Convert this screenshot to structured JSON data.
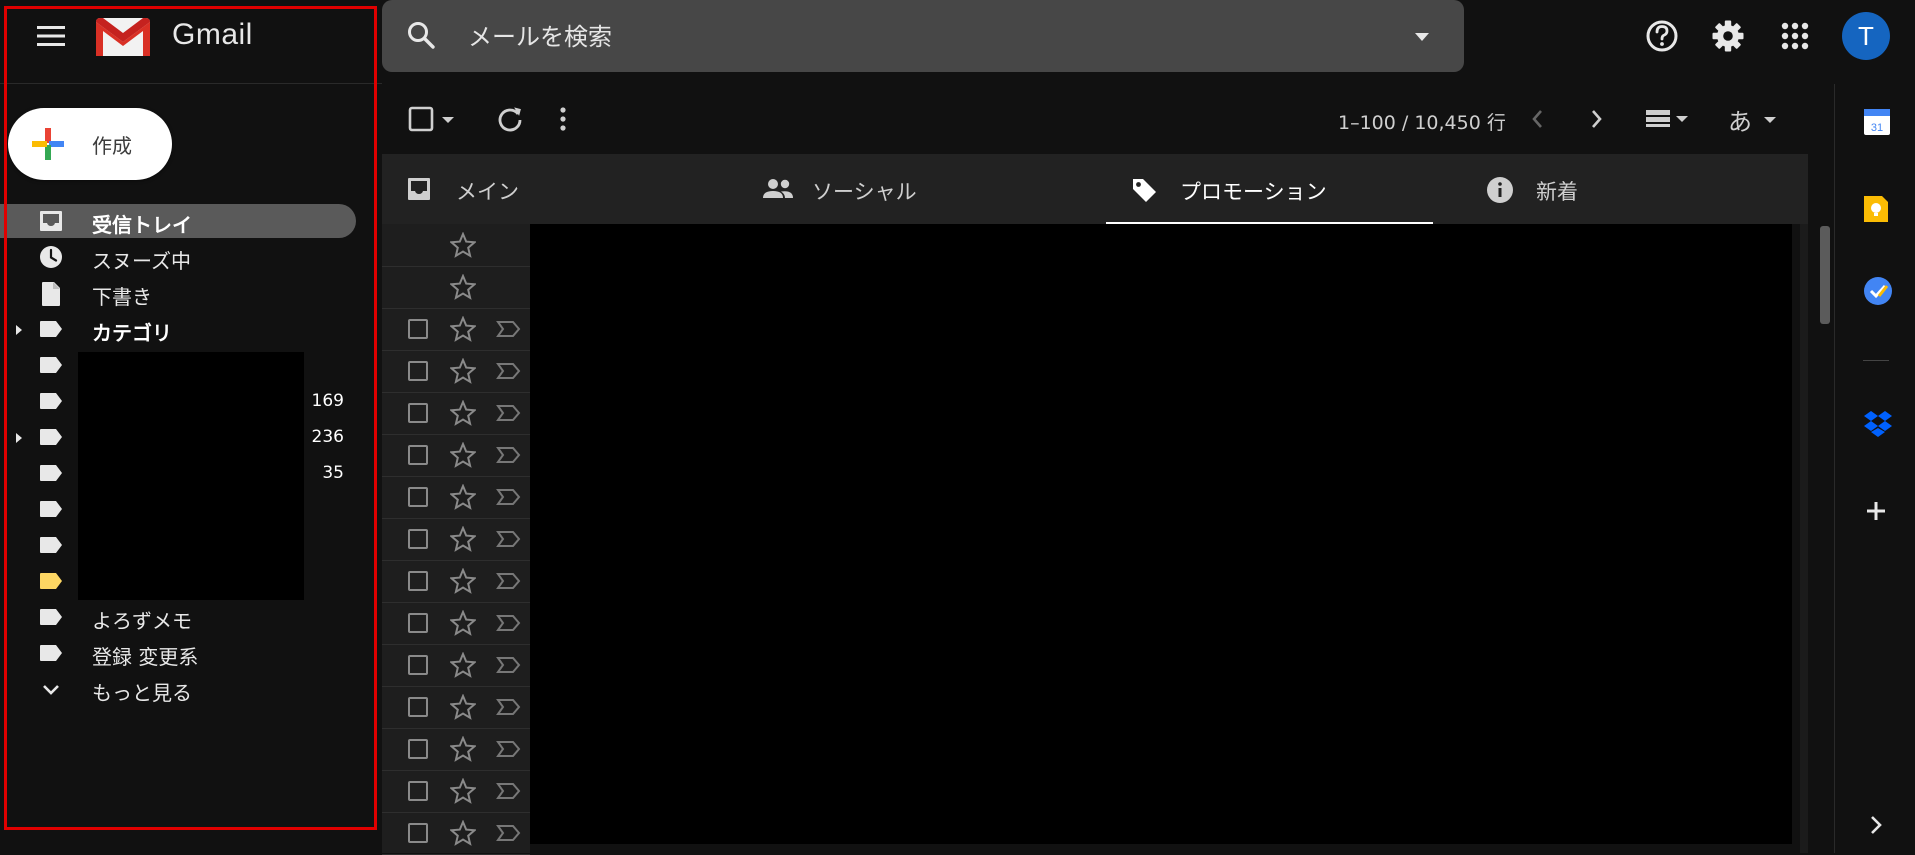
{
  "header": {
    "brand": "Gmail",
    "search_placeholder": "メールを検索",
    "avatar_letter": "T"
  },
  "compose": {
    "label": "作成"
  },
  "sidebar": {
    "items": [
      {
        "label": "受信トレイ",
        "icon": "inbox-icon",
        "active": true,
        "bold": true
      },
      {
        "label": "スヌーズ中",
        "icon": "clock-icon"
      },
      {
        "label": "下書き",
        "icon": "draft-icon"
      },
      {
        "label": "カテゴリ",
        "icon": "label-icon",
        "bold": true,
        "expandable": true
      },
      {
        "label": "",
        "icon": "label-icon",
        "count": ""
      },
      {
        "label": "",
        "icon": "label-icon",
        "count": "169"
      },
      {
        "label": "",
        "icon": "label-icon",
        "count": "236",
        "expandable": true
      },
      {
        "label": "",
        "icon": "label-icon",
        "count": "35"
      },
      {
        "label": "",
        "icon": "label-icon",
        "count": ""
      },
      {
        "label": "",
        "icon": "label-icon",
        "count": ""
      },
      {
        "label": "",
        "icon": "label-icon",
        "count": "",
        "color": "#fdd663"
      },
      {
        "label": "よろずメモ",
        "icon": "label-icon"
      },
      {
        "label": "登録 変更系",
        "icon": "label-icon"
      },
      {
        "label": "もっと見る",
        "icon": "chevron-down-icon"
      }
    ]
  },
  "toolbar": {
    "page_count": "1–100 / 10,450 行",
    "input_tool_label": "あ"
  },
  "tabs": [
    {
      "label": "メイン",
      "icon": "inbox-icon"
    },
    {
      "label": "ソーシャル",
      "icon": "people-icon"
    },
    {
      "label": "プロモーション",
      "icon": "tag-icon",
      "selected": true
    },
    {
      "label": "新着",
      "icon": "info-icon"
    }
  ],
  "colors": {
    "background": "#111111",
    "search_bg": "#474747",
    "active_nav": "#5a5a5a",
    "avatar": "#1565c0",
    "highlight_frame": "#e00000"
  }
}
